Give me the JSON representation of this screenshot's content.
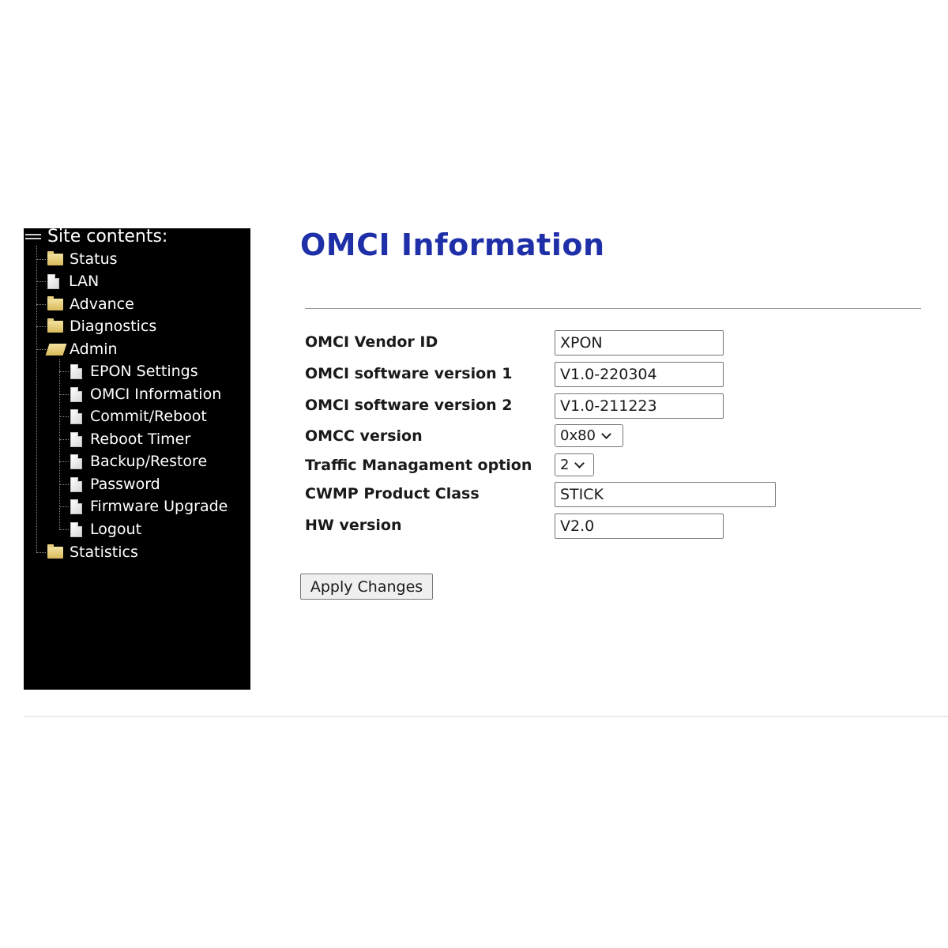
{
  "sidebar": {
    "title": "Site contents:",
    "items": [
      {
        "label": "Status",
        "icon": "folder-icon"
      },
      {
        "label": "LAN",
        "icon": "document-icon"
      },
      {
        "label": "Advance",
        "icon": "folder-icon"
      },
      {
        "label": "Diagnostics",
        "icon": "folder-icon"
      },
      {
        "label": "Admin",
        "icon": "folder-open-icon",
        "expanded": true,
        "children": [
          {
            "label": "EPON Settings",
            "icon": "document-icon"
          },
          {
            "label": "OMCI Information",
            "icon": "document-icon"
          },
          {
            "label": "Commit/Reboot",
            "icon": "document-icon"
          },
          {
            "label": "Reboot Timer",
            "icon": "document-icon"
          },
          {
            "label": "Backup/Restore",
            "icon": "document-icon"
          },
          {
            "label": "Password",
            "icon": "document-icon"
          },
          {
            "label": "Firmware Upgrade",
            "icon": "document-icon"
          },
          {
            "label": "Logout",
            "icon": "document-icon"
          }
        ]
      },
      {
        "label": "Statistics",
        "icon": "folder-icon"
      }
    ]
  },
  "main": {
    "title": "OMCI Information",
    "title_color": "#1f2fa8",
    "fields": {
      "vendor_id": {
        "label": "OMCI Vendor ID",
        "value": "XPON"
      },
      "sw_version_1": {
        "label": "OMCI software version 1",
        "value": "V1.0-220304"
      },
      "sw_version_2": {
        "label": "OMCI software version 2",
        "value": "V1.0-211223"
      },
      "omcc_version": {
        "label": "OMCC version",
        "value": "0x80"
      },
      "traffic_option": {
        "label": "Traffic Managament option",
        "value": "2"
      },
      "cwmp_class": {
        "label": "CWMP Product Class",
        "value": "STICK"
      },
      "hw_version": {
        "label": "HW version",
        "value": "V2.0"
      }
    },
    "apply_label": "Apply Changes"
  }
}
